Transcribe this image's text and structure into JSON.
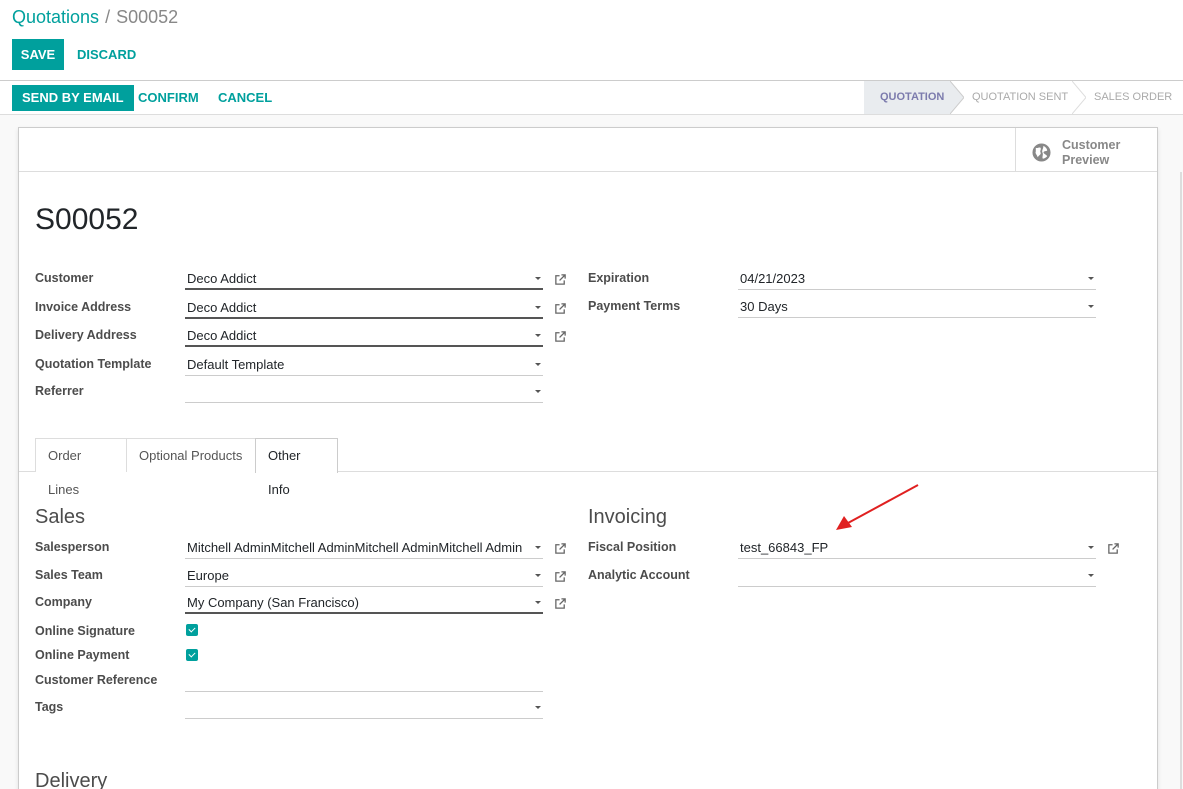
{
  "breadcrumb": {
    "parent": "Quotations",
    "separator": "/",
    "current": "S00052"
  },
  "actions": {
    "save": "SAVE",
    "discard": "DISCARD"
  },
  "statusbar": {
    "buttons": {
      "send_email": "SEND BY EMAIL",
      "confirm": "CONFIRM",
      "cancel": "CANCEL"
    },
    "stages": [
      "QUOTATION",
      "QUOTATION SENT",
      "SALES ORDER"
    ],
    "active_stage": "QUOTATION"
  },
  "button_box": {
    "preview_line1": "Customer",
    "preview_line2": "Preview",
    "preview_icon": "globe-icon"
  },
  "record": {
    "title": "S00052"
  },
  "left_fields": [
    {
      "label": "Customer",
      "value": "Deco Addict"
    },
    {
      "label": "Invoice Address",
      "value": "Deco Addict"
    },
    {
      "label": "Delivery Address",
      "value": "Deco Addict"
    },
    {
      "label": "Quotation Template",
      "value": "Default Template"
    },
    {
      "label": "Referrer",
      "value": ""
    }
  ],
  "right_fields": [
    {
      "label": "Expiration",
      "value": "04/21/2023"
    },
    {
      "label": "Payment Terms",
      "value": "30 Days"
    }
  ],
  "tabs": [
    "Order Lines",
    "Optional Products",
    "Other Info"
  ],
  "active_tab": "Other Info",
  "sales": {
    "heading": "Sales",
    "fields": [
      {
        "label": "Salesperson",
        "value": "Mitchell AdminMitchell AdminMitchell AdminMitchell Admin"
      },
      {
        "label": "Sales Team",
        "value": "Europe"
      },
      {
        "label": "Company",
        "value": "My Company (San Francisco)"
      },
      {
        "label": "Online Signature",
        "checked": true
      },
      {
        "label": "Online Payment",
        "checked": true
      },
      {
        "label": "Customer Reference",
        "value": ""
      },
      {
        "label": "Tags",
        "value": ""
      }
    ]
  },
  "invoicing": {
    "heading": "Invoicing",
    "fields": [
      {
        "label": "Fiscal Position",
        "value": "test_66843_FP"
      },
      {
        "label": "Analytic Account",
        "value": ""
      }
    ]
  },
  "delivery": {
    "heading": "Delivery"
  },
  "colors": {
    "accent": "#00a09d",
    "stage_active": "#7c7bad",
    "annotation_arrow": "#e02020"
  }
}
